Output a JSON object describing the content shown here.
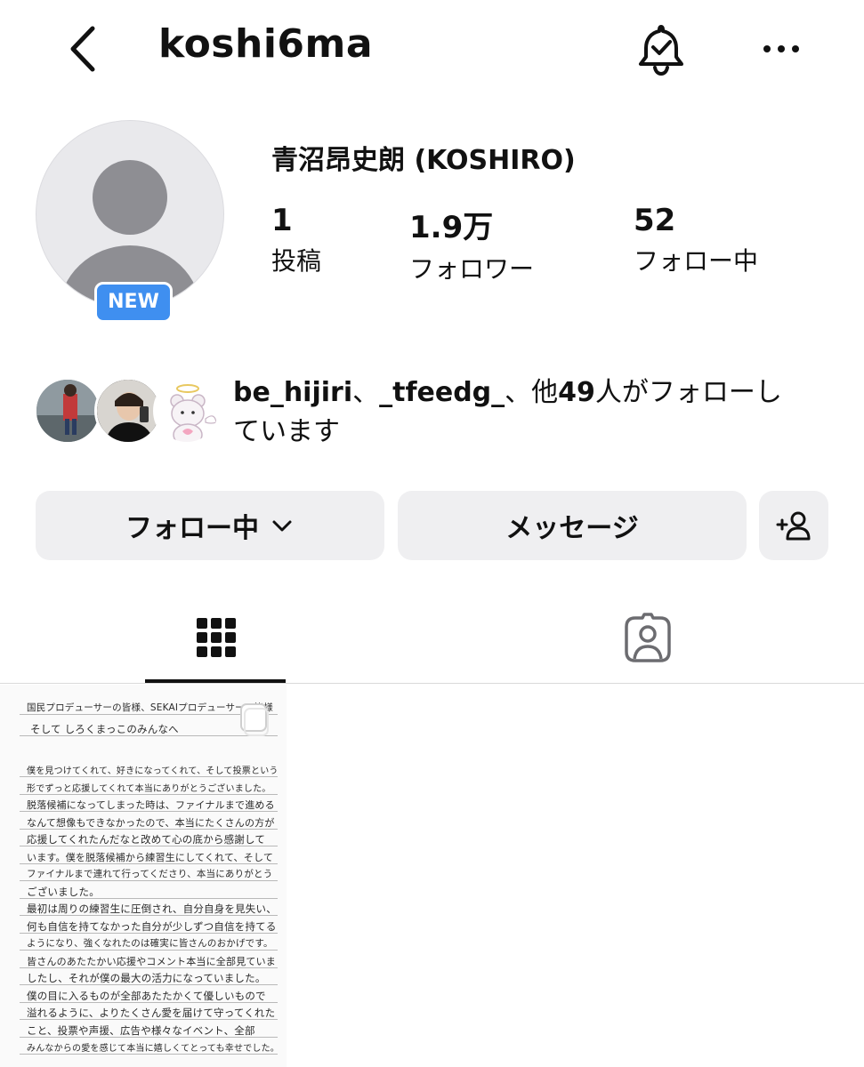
{
  "header": {
    "username": "koshi6ma",
    "back_icon": "chevron-left-icon",
    "notification_icon": "bell-check-icon",
    "more_icon": "more-horizontal-icon"
  },
  "profile": {
    "full_name": "青沼昂史朗 (KOSHIRO)",
    "badge": "NEW",
    "stats": [
      {
        "value": "1",
        "label": "投稿"
      },
      {
        "value": "1.9万",
        "label": "フォロワー"
      },
      {
        "value": "52",
        "label": "フォロー中"
      }
    ]
  },
  "followed_by": {
    "user1": "be_hijiri",
    "sep": "、",
    "user2": "_tfeedg_",
    "others": "、他",
    "count": "49",
    "suffix": "人がフォローし",
    "line2": "ています"
  },
  "actions": {
    "following_label": "フォロー中",
    "message_label": "メッセージ",
    "add_friend_icon": "person-add-icon"
  },
  "tabs": [
    {
      "icon": "grid-icon",
      "active": true
    },
    {
      "icon": "tagged-person-icon",
      "active": false
    }
  ],
  "post": {
    "lines_header": [
      "国民プロデューサーの皆様、SEKAIプロデューサーの皆様",
      "そして しろくまっこのみんなへ"
    ],
    "lines_body": [
      "僕を見つけてくれて、好きになってくれて、そして投票という",
      "形でずっと応援してくれて本当にありがとうございました。",
      "脱落候補になってしまった時は、ファイナルまで進める",
      "なんて想像もできなかったので、本当にたくさんの方が",
      "応援してくれたんだなと改めて心の底から感謝して",
      "います。僕を脱落候補から練習生にしてくれて、そして",
      "ファイナルまで連れて行ってくださり、本当にありがとう",
      "ございました。",
      "最初は周りの練習生に圧倒され、自分自身を見失い、",
      "何も自信を持てなかった自分が少しずつ自信を持てる",
      "ようになり、強くなれたのは確実に皆さんのおかげです。",
      "皆さんのあたたかい応援やコメント本当に全部見ていま",
      "したし、それが僕の最大の活力になっていました。",
      "僕の目に入るものが全部あたたかくて優しいもので",
      "溢れるように、よりたくさん愛を届けて守ってくれた",
      "こと、投票や声援、広告や様々なイベント、全部",
      "みんなからの愛を感じて本当に嬉しくてとっても幸せでした。"
    ]
  }
}
